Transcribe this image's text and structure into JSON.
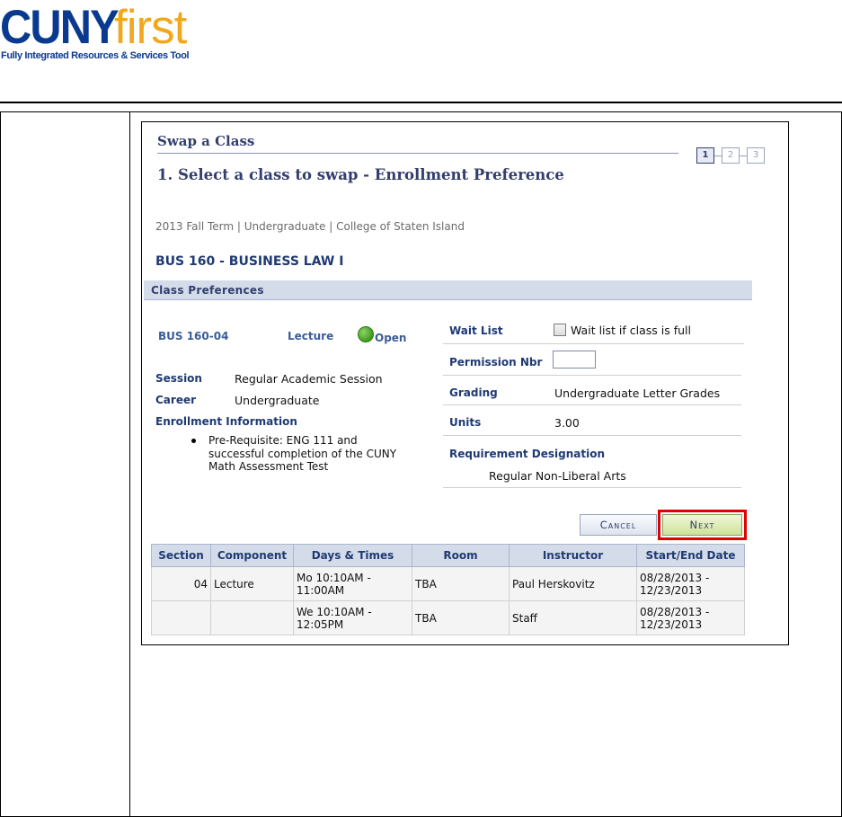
{
  "header": {
    "logo_cuny": "CUNY",
    "logo_first": "first",
    "logo_tagline": "Fully Integrated Resources & Services Tool"
  },
  "page": {
    "title": "Swap a Class",
    "steps": [
      "1",
      "2",
      "3"
    ],
    "active_step": 1,
    "step_heading": "1.  Select a class to swap - Enrollment Preference",
    "term_line": "2013 Fall Term | Undergraduate | College of Staten Island",
    "course_title": "BUS  160 - BUSINESS LAW I"
  },
  "preferences": {
    "section_header": "Class Preferences",
    "class_section": "BUS  160-04",
    "component": "Lecture",
    "status": "Open",
    "status_color": "#4caf2a",
    "session_label": "Session",
    "session_value": "Regular Academic Session",
    "career_label": "Career",
    "career_value": "Undergraduate",
    "enrollment_info_label": "Enrollment Information",
    "enrollment_info_item": "Pre-Requisite: ENG 111 and successful completion of the CUNY Math Assessment Test",
    "wait_list_label": "Wait List",
    "wait_list_checkbox_label": "Wait list if class is full",
    "wait_list_checked": false,
    "permission_label": "Permission Nbr",
    "permission_value": "",
    "grading_label": "Grading",
    "grading_value": "Undergraduate Letter Grades",
    "units_label": "Units",
    "units_value": "3.00",
    "requirement_label": "Requirement Designation",
    "requirement_value": "Regular Non-Liberal Arts"
  },
  "buttons": {
    "cancel": "Cancel",
    "next": "Next"
  },
  "meetings": {
    "headers": [
      "Section",
      "Component",
      "Days & Times",
      "Room",
      "Instructor",
      "Start/End Date"
    ],
    "rows": [
      [
        "04",
        "Lecture",
        "Mo 10:10AM - 11:00AM",
        "TBA",
        "Paul Herskovitz",
        "08/28/2013 - 12/23/2013"
      ],
      [
        "",
        "",
        "We 10:10AM - 12:05PM",
        "TBA",
        "Staff",
        "08/28/2013 - 12/23/2013"
      ]
    ]
  },
  "colors": {
    "logo_blue": "#0a3a8f",
    "logo_gold": "#f2a81d",
    "heading_navy": "#333e6e",
    "highlight_red": "#e00000"
  }
}
